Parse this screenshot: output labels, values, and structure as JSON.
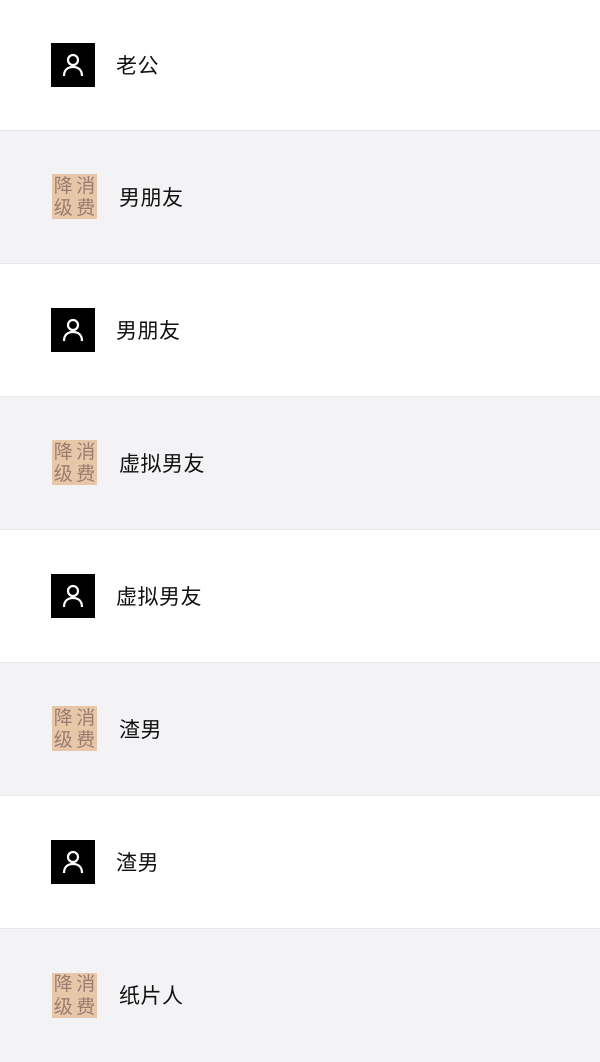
{
  "items": [
    {
      "label": "老公",
      "kind": "avatar",
      "icon": "user-icon"
    },
    {
      "label": "男朋友",
      "kind": "badge",
      "badge_chars": [
        "降",
        "消",
        "级",
        "费"
      ]
    },
    {
      "label": "男朋友",
      "kind": "avatar",
      "icon": "user-icon"
    },
    {
      "label": "虚拟男友",
      "kind": "badge",
      "badge_chars": [
        "降",
        "消",
        "级",
        "费"
      ]
    },
    {
      "label": "虚拟男友",
      "kind": "avatar",
      "icon": "user-icon"
    },
    {
      "label": "渣男",
      "kind": "badge",
      "badge_chars": [
        "降",
        "消",
        "级",
        "费"
      ]
    },
    {
      "label": "渣男",
      "kind": "avatar",
      "icon": "user-icon"
    },
    {
      "label": "纸片人",
      "kind": "badge",
      "badge_chars": [
        "降",
        "消",
        "级",
        "费"
      ]
    }
  ],
  "colors": {
    "avatar_bg": "#000000",
    "badge_bg": "#e8c6a8",
    "badge_text": "#9a7d72",
    "row_alt_bg": "#f3f3f5",
    "divider": "#e8e8ea"
  }
}
